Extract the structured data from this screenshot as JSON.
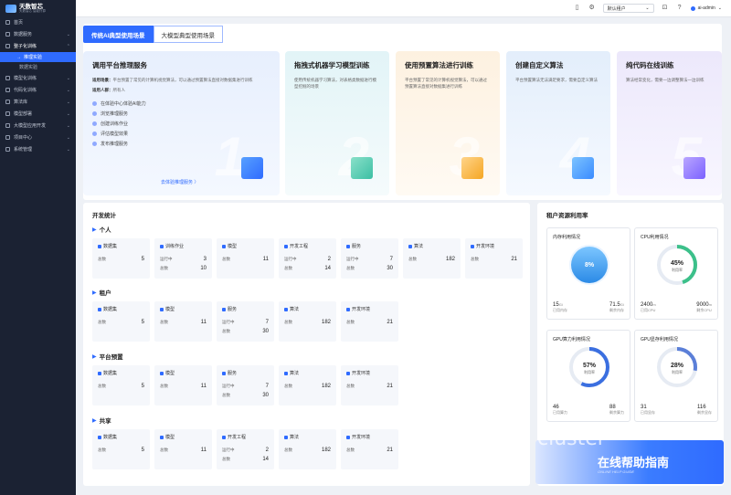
{
  "brand": {
    "name": "天数智芯",
    "slogan": "天数智芯 智能计算"
  },
  "sidebar": {
    "items": [
      {
        "label": "首页",
        "chevron": ""
      },
      {
        "label": "数据服务",
        "chevron": "⌄"
      },
      {
        "label": "整子化训练",
        "chevron": "⌃"
      },
      {
        "label": "推理实验",
        "chevron": ""
      },
      {
        "label": "数据实验",
        "chevron": ""
      },
      {
        "label": "模型化训练",
        "chevron": "⌄"
      },
      {
        "label": "代码化训练",
        "chevron": "⌄"
      },
      {
        "label": "算法库",
        "chevron": "⌄"
      },
      {
        "label": "模型部署",
        "chevron": "⌄"
      },
      {
        "label": "大模型应用开发",
        "chevron": "⌄"
      },
      {
        "label": "项目中心",
        "chevron": "⌄"
      },
      {
        "label": "系统管理",
        "chevron": "⌄"
      }
    ]
  },
  "topbar": {
    "select": "默认租户",
    "user": "ai-admin"
  },
  "tabs": [
    "传统AI典型使用场景",
    "大模型典型使用场景"
  ],
  "cards": [
    {
      "title": "调用平台推理服务",
      "scenario_label": "适用场景：",
      "scenario": "平台预置了常见的计算机视觉算法，可以通过预置算法直接对数据集进行训练",
      "people_label": "适用人群：",
      "people": "所有人",
      "steps": [
        "在体验中心体验AI能力",
        "浏览推理服务",
        "创建训练作业",
        "评估模型效果",
        "发布推理服务"
      ],
      "link": "去体验推理服务 〉",
      "num": "1"
    },
    {
      "title": "拖拽式机器学习模型训练",
      "desc": "使用传统机器学习算法，对表格类数据进行模型挖掘的场景",
      "num": "2"
    },
    {
      "title": "使用预置算法进行训练",
      "desc": "平台预置了常见的计算机视觉算法，可以通过预置算法直接对数据集进行训练",
      "num": "3"
    },
    {
      "title": "创建自定义算法",
      "desc": "平台预置算法无法满足要求，需要自定义算法",
      "num": "4"
    },
    {
      "title": "纯代码在线训练",
      "desc": "算法经常变化，需要一边调整算法一边训练",
      "num": "5"
    }
  ],
  "dev": {
    "title": "开发统计",
    "groups": [
      {
        "name": "个人",
        "tiles": [
          {
            "name": "数据集",
            "rows": [
              [
                "总数",
                "5"
              ]
            ]
          },
          {
            "name": "训练作业",
            "rows": [
              [
                "运行中",
                "3"
              ],
              [
                "总数",
                "10"
              ]
            ]
          },
          {
            "name": "模型",
            "rows": [
              [
                "总数",
                "11"
              ]
            ]
          },
          {
            "name": "开发工程",
            "rows": [
              [
                "运行中",
                "2"
              ],
              [
                "总数",
                "14"
              ]
            ]
          },
          {
            "name": "服务",
            "rows": [
              [
                "运行中",
                "7"
              ],
              [
                "总数",
                "30"
              ]
            ]
          },
          {
            "name": "算法",
            "rows": [
              [
                "总数",
                "182"
              ]
            ]
          },
          {
            "name": "开发环境",
            "rows": [
              [
                "总数",
                "21"
              ]
            ]
          }
        ]
      },
      {
        "name": "租户",
        "tiles": [
          {
            "name": "数据集",
            "rows": [
              [
                "总数",
                "5"
              ]
            ]
          },
          {
            "name": "模型",
            "rows": [
              [
                "总数",
                "11"
              ]
            ]
          },
          {
            "name": "服务",
            "rows": [
              [
                "运行中",
                "7"
              ],
              [
                "总数",
                "30"
              ]
            ]
          },
          {
            "name": "算法",
            "rows": [
              [
                "总数",
                "182"
              ]
            ]
          },
          {
            "name": "开发环境",
            "rows": [
              [
                "总数",
                "21"
              ]
            ]
          }
        ]
      },
      {
        "name": "平台预置",
        "tiles": [
          {
            "name": "数据集",
            "rows": [
              [
                "总数",
                "5"
              ]
            ]
          },
          {
            "name": "模型",
            "rows": [
              [
                "总数",
                "11"
              ]
            ]
          },
          {
            "name": "服务",
            "rows": [
              [
                "运行中",
                "7"
              ],
              [
                "总数",
                "30"
              ]
            ]
          },
          {
            "name": "算法",
            "rows": [
              [
                "总数",
                "182"
              ]
            ]
          },
          {
            "name": "开发环境",
            "rows": [
              [
                "总数",
                "21"
              ]
            ]
          }
        ]
      },
      {
        "name": "共享",
        "tiles": [
          {
            "name": "数据集",
            "rows": [
              [
                "总数",
                "5"
              ]
            ]
          },
          {
            "name": "模型",
            "rows": [
              [
                "总数",
                "11"
              ]
            ]
          },
          {
            "name": "开发工程",
            "rows": [
              [
                "运行中",
                "2"
              ],
              [
                "总数",
                "14"
              ]
            ]
          },
          {
            "name": "算法",
            "rows": [
              [
                "总数",
                "182"
              ]
            ]
          },
          {
            "name": "开发环境",
            "rows": [
              [
                "总数",
                "21"
              ]
            ]
          }
        ]
      }
    ]
  },
  "resources": {
    "title": "租户资源利用率",
    "cards": [
      {
        "name": "内存利用情况",
        "pct": "8%",
        "level": 0.08,
        "sublabel": "",
        "color": "#3aa0f0",
        "stats": [
          [
            "15",
            "Gi",
            "已用内存"
          ],
          [
            "71.5",
            "Gi",
            "剩余内存"
          ]
        ],
        "type": "water"
      },
      {
        "name": "CPU利用情况",
        "pct": "45%",
        "level": 0.45,
        "sublabel": "利用率",
        "color": "#3cc08a",
        "stats": [
          [
            "2400",
            "m",
            "已用CPU"
          ],
          [
            "9000",
            "m",
            "剩余CPU"
          ]
        ],
        "type": "ring"
      },
      {
        "name": "GPU算力利用情况",
        "pct": "57%",
        "level": 0.57,
        "sublabel": "利用率",
        "color": "#3b6fe0",
        "stats": [
          [
            "46",
            "",
            "已用算力"
          ],
          [
            "88",
            "",
            "剩余算力"
          ]
        ],
        "type": "ring"
      },
      {
        "name": "GPU显存利用情况",
        "pct": "28%",
        "level": 0.28,
        "sublabel": "利用率",
        "color": "#5b7fd8",
        "stats": [
          [
            "31",
            "",
            "已用显存"
          ],
          [
            "116",
            "",
            "剩余显存"
          ]
        ],
        "type": "ring"
      }
    ]
  },
  "banner": {
    "ghost": "cluster",
    "title": "在线帮助指南",
    "sub": "ONLINE HELP GUIDE"
  }
}
